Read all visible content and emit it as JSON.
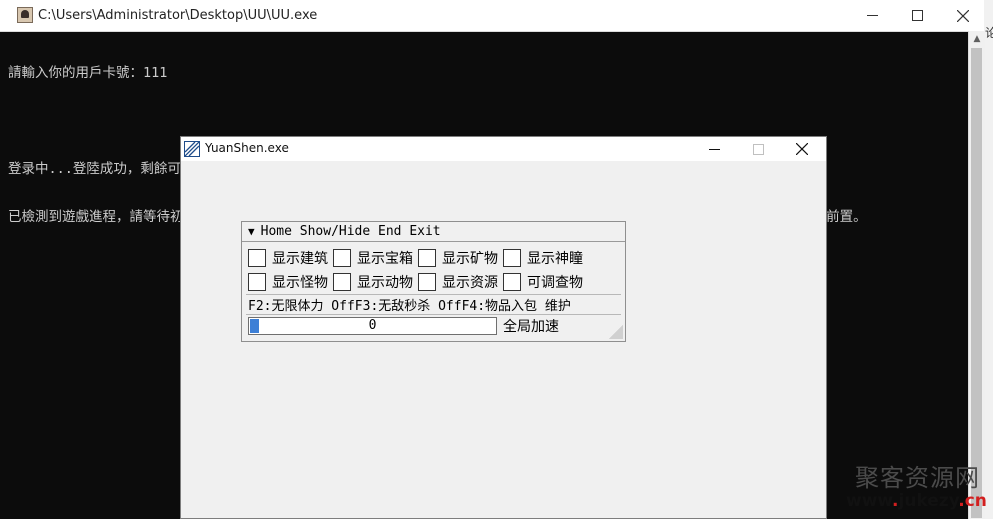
{
  "console": {
    "title": "C:\\Users\\Administrator\\Desktop\\UU\\UU.exe",
    "lines": [
      "請輸入你的用戶卡號：111",
      "",
      "登录中...登陸成功，剩餘可測試使用本程式時間為：25天17小时17分2秒",
      "已檢測到遊戲進程，請等待初始化 初始成功會有文本提示初始化数据成功，请等待，菜单将在鼠标焦点存在与游戏内时出现，请激活游戏前置。"
    ]
  },
  "dialog": {
    "title": "YuanShen.exe",
    "panel": {
      "header": "Home Show/Hide End Exit",
      "row1": [
        "显示建筑",
        "显示宝箱",
        "显示矿物",
        "显示神瞳"
      ],
      "row2": [
        "显示怪物",
        "显示动物",
        "显示资源",
        "可调查物"
      ],
      "hotkeys": "F2:无限体力 OffF3:无敌秒杀 OffF4:物品入包 维护",
      "speed_value": "0",
      "speed_label": "全局加速"
    }
  },
  "watermark": {
    "cn": "聚客资源网",
    "url_pre": "www",
    "url_dot1": ".",
    "url_mid": "jukezy",
    "url_dot2": ".",
    "url_end": "cn"
  },
  "right_fragment": "论",
  "icons": [
    "app-icon",
    "minimize-icon",
    "maximize-icon",
    "close-icon",
    "triangle-down-icon",
    "scroll-up-icon"
  ]
}
